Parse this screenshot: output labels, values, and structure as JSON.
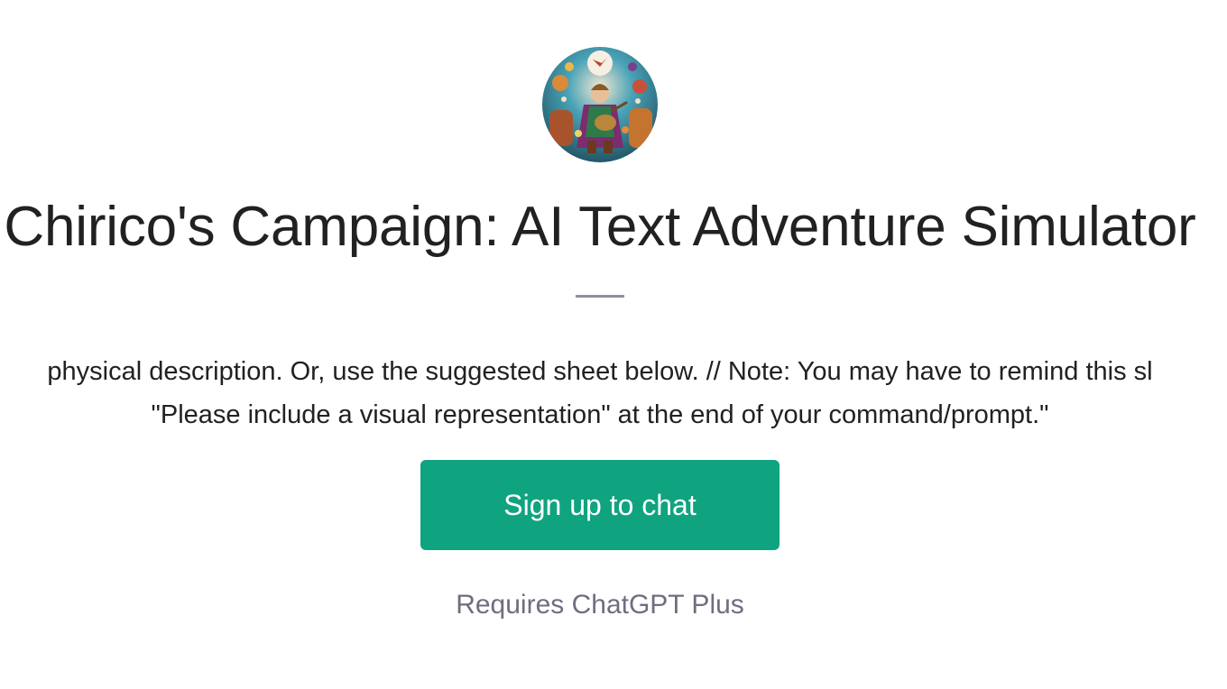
{
  "gpt": {
    "avatar_icon": "bard-playing-lute-avatar",
    "title": "Chirico's Campaign: AI Text Adventure Simulator",
    "description_lines": [
      "physical description. Or, use the suggested sheet below. // Note: You may have to remind this sl",
      "\"Please include a visual representation\" at the end of your command/prompt.\""
    ]
  },
  "actions": {
    "signup_label": "Sign up to chat",
    "requirement_note": "Requires ChatGPT Plus"
  },
  "colors": {
    "accent": "#10a37f",
    "text": "#202123",
    "muted": "#6e6e80",
    "divider": "#8e8ea0"
  }
}
